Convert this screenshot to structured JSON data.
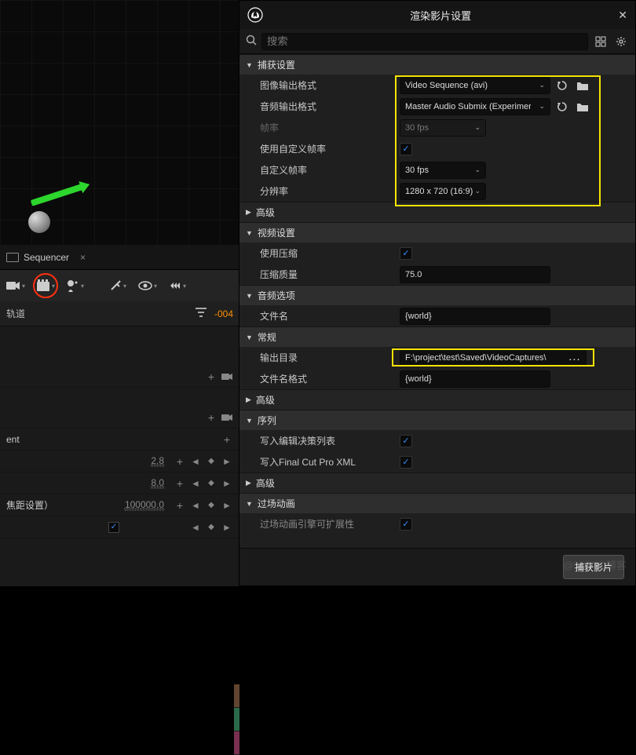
{
  "sequencer": {
    "tab_label": "Sequencer",
    "track_header": "轨道",
    "time_value": "-004",
    "rows": {
      "ent": "ent",
      "focus": "焦距设置）",
      "v1": "2.8",
      "v2": "8.0",
      "v3": "100000.0"
    }
  },
  "panel": {
    "title": "渲染影片设置",
    "search_placeholder": "搜索"
  },
  "sections": {
    "capture": "捕获设置",
    "advanced": "高级",
    "video": "视频设置",
    "audio": "音频选项",
    "general": "常规",
    "sequence": "序列",
    "cinematic": "过场动画"
  },
  "props": {
    "image_format": {
      "label": "图像输出格式",
      "value": "Video Sequence (avi)"
    },
    "audio_format": {
      "label": "音频输出格式",
      "value": "Master Audio Submix (Experimer"
    },
    "framerate": {
      "label": "帧率",
      "value": "30 fps"
    },
    "use_custom_rate": {
      "label": "使用自定义帧率"
    },
    "custom_rate": {
      "label": "自定义帧率",
      "value": "30 fps"
    },
    "resolution": {
      "label": "分辨率",
      "value": "1280 x 720 (16:9)"
    },
    "use_compression": {
      "label": "使用压缩"
    },
    "compression_quality": {
      "label": "压缩质量",
      "value": "75.0"
    },
    "filename_audio": {
      "label": "文件名",
      "value": "{world}"
    },
    "output_dir": {
      "label": "输出目录",
      "value": "F:\\project\\test\\Saved\\VideoCaptures\\"
    },
    "filename_fmt": {
      "label": "文件名格式",
      "value": "{world}"
    },
    "write_edl": {
      "label": "写入编辑决策列表"
    },
    "write_fcp": {
      "label": "写入Final Cut Pro XML"
    },
    "cinematic_ext": {
      "label": "过场动画引擎可扩展性"
    }
  },
  "footer": {
    "capture": "捕获影片"
  },
  "watermark": "@51CTO博客"
}
